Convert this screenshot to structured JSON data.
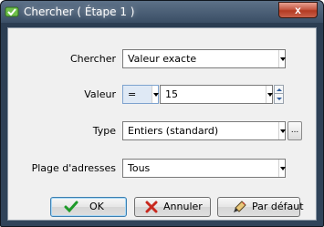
{
  "window": {
    "title": "Chercher ( Étape 1 )",
    "close_label": "x"
  },
  "form": {
    "chercher": {
      "label": "Chercher",
      "value": "Valeur exacte"
    },
    "valeur": {
      "label": "Valeur",
      "operator": "=",
      "value": "15"
    },
    "type": {
      "label": "Type",
      "value": "Entiers (standard)",
      "browse_label": "..."
    },
    "plage": {
      "label": "Plage d'adresses",
      "value": "Tous"
    }
  },
  "buttons": {
    "ok": "OK",
    "annuler": "Annuler",
    "defaut": "Par défaut"
  },
  "colors": {
    "ok_check": "#1e9a2a",
    "cancel_x": "#c8281e"
  }
}
